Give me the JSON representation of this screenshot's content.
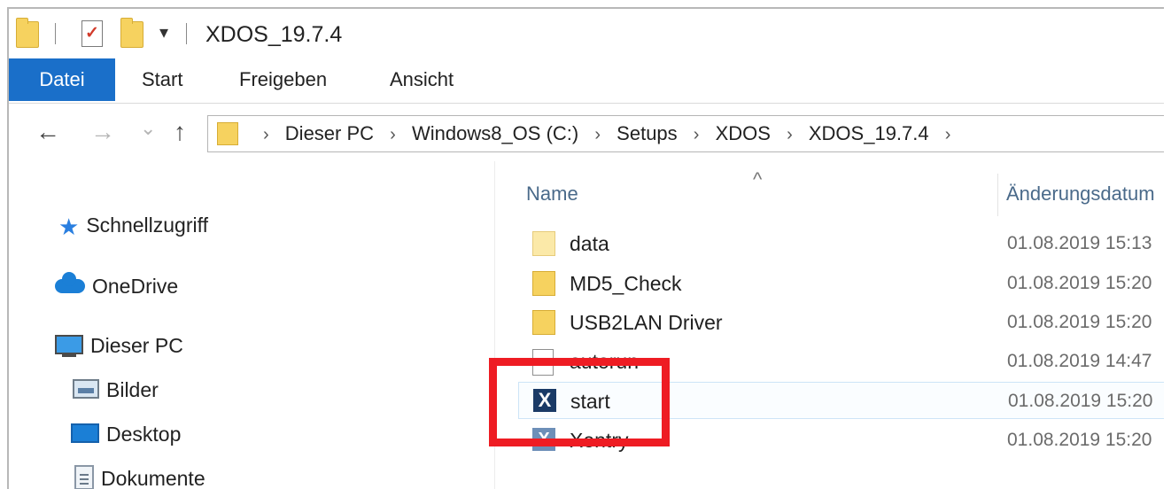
{
  "window": {
    "title": "XDOS_19.7.4"
  },
  "ribbon": {
    "tabs": [
      "Datei",
      "Start",
      "Freigeben",
      "Ansicht"
    ]
  },
  "nav": {
    "back": "←",
    "forward": "→",
    "recent": "⌄",
    "up": "↑",
    "breadcrumb": [
      "Dieser PC",
      "Windows8_OS (C:)",
      "Setups",
      "XDOS",
      "XDOS_19.7.4"
    ],
    "separator": "›"
  },
  "sidebar": {
    "items": [
      {
        "label": "Schnellzugriff",
        "icon": "star-icon"
      },
      {
        "label": "OneDrive",
        "icon": "cloud-icon"
      },
      {
        "label": "Dieser PC",
        "icon": "computer-icon"
      },
      {
        "label": "Bilder",
        "icon": "pictures-icon"
      },
      {
        "label": "Desktop",
        "icon": "desktop-icon"
      },
      {
        "label": "Dokumente",
        "icon": "documents-icon"
      }
    ]
  },
  "filelist": {
    "columns": {
      "name": "Name",
      "date": "Änderungsdatum",
      "sort_indicator": "^"
    },
    "rows": [
      {
        "name": "data",
        "date": "01.08.2019 15:13",
        "icon": "folder-icon"
      },
      {
        "name": "MD5_Check",
        "date": "01.08.2019 15:20",
        "icon": "folder-icon"
      },
      {
        "name": "USB2LAN Driver",
        "date": "01.08.2019 15:20",
        "icon": "folder-icon"
      },
      {
        "name": "autorun",
        "date": "01.08.2019 14:47",
        "icon": "file-icon"
      },
      {
        "name": "start",
        "date": "01.08.2019 15:20",
        "icon": "app-icon"
      },
      {
        "name": "Xentry",
        "date": "01.08.2019 15:20",
        "icon": "app-icon"
      }
    ]
  },
  "colors": {
    "accent": "#1a6fc9",
    "highlight": "#ee1c23",
    "folder": "#f6d25f"
  }
}
